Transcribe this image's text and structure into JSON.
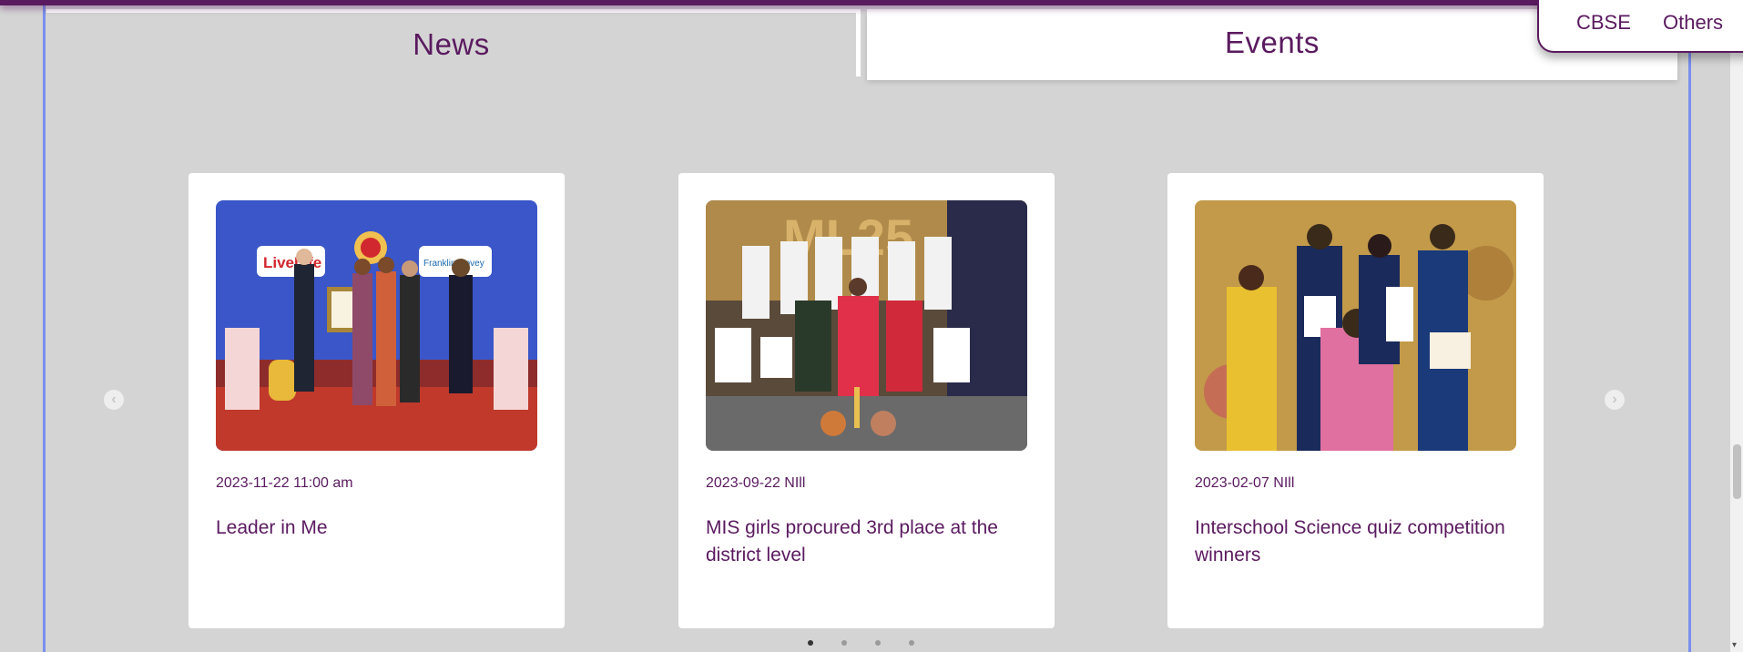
{
  "tabs": {
    "news": "News",
    "events": "Events"
  },
  "dropdown": {
    "items": [
      "CBSE",
      "Others"
    ]
  },
  "cards": [
    {
      "date": "2023-11-22 11:00 am",
      "title": "Leader in Me",
      "image_logos": [
        "LiveLife",
        "Franklin Covey"
      ]
    },
    {
      "date": "2023-09-22 NIll",
      "title": "MIS girls procured 3rd place at the district level",
      "image_logos": [
        "ML25"
      ]
    },
    {
      "date": "2023-02-07 NIll",
      "title": "Interschool Science quiz competition winners",
      "image_logos": []
    }
  ],
  "carousel": {
    "prev_icon": "chevron-left-icon",
    "next_icon": "chevron-right-icon",
    "page_count": 4,
    "active_page": 1
  },
  "colors": {
    "brand": "#5a1a5f",
    "background": "#d4d4d4",
    "panel_border": "#7a8ff0"
  }
}
